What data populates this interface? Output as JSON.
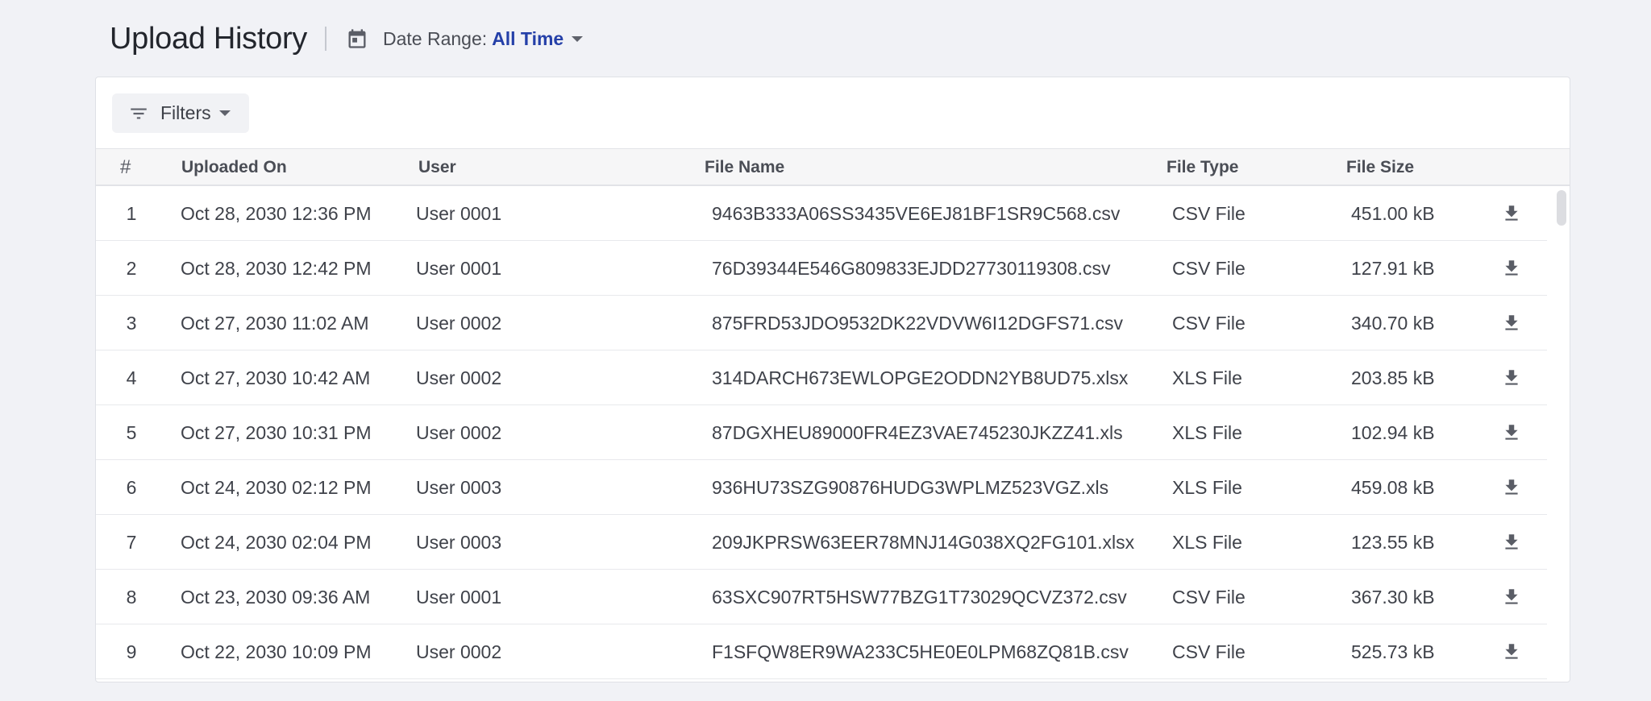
{
  "header": {
    "title": "Upload History",
    "date_range_label": "Date Range:",
    "date_range_value": "All Time"
  },
  "toolbar": {
    "filters_label": "Filters"
  },
  "table": {
    "columns": [
      "#",
      "Uploaded On",
      "User",
      "File Name",
      "File Type",
      "File Size"
    ],
    "rows": [
      {
        "num": "1",
        "uploaded": "Oct 28, 2030 12:36 PM",
        "user": "User 0001",
        "file": "9463B333A06SS3435VE6EJ81BF1SR9C568.csv",
        "type": "CSV File",
        "size": "451.00 kB"
      },
      {
        "num": "2",
        "uploaded": "Oct 28, 2030 12:42 PM",
        "user": "User 0001",
        "file": "76D39344E546G809833EJDD27730119308.csv",
        "type": "CSV File",
        "size": "127.91 kB"
      },
      {
        "num": "3",
        "uploaded": "Oct 27, 2030 11:02 AM",
        "user": "User 0002",
        "file": "875FRD53JDO9532DK22VDVW6I12DGFS71.csv",
        "type": "CSV File",
        "size": "340.70 kB"
      },
      {
        "num": "4",
        "uploaded": "Oct 27, 2030 10:42 AM",
        "user": "User 0002",
        "file": "314DARCH673EWLOPGE2ODDN2YB8UD75.xlsx",
        "type": "XLS File",
        "size": "203.85 kB"
      },
      {
        "num": "5",
        "uploaded": "Oct 27, 2030 10:31 PM",
        "user": "User 0002",
        "file": "87DGXHEU89000FR4EZ3VAE745230JKZZ41.xls",
        "type": "XLS File",
        "size": "102.94 kB"
      },
      {
        "num": "6",
        "uploaded": "Oct 24, 2030 02:12 PM",
        "user": "User 0003",
        "file": "936HU73SZG90876HUDG3WPLMZ523VGZ.xls",
        "type": "XLS File",
        "size": "459.08 kB"
      },
      {
        "num": "7",
        "uploaded": "Oct 24, 2030 02:04 PM",
        "user": "User 0003",
        "file": "209JKPRSW63EER78MNJ14G038XQ2FG101.xlsx",
        "type": "XLS File",
        "size": "123.55 kB"
      },
      {
        "num": "8",
        "uploaded": "Oct 23, 2030 09:36 AM",
        "user": "User 0001",
        "file": "63SXC907RT5HSW77BZG1T73029QCVZ372.csv",
        "type": "CSV File",
        "size": "367.30 kB"
      },
      {
        "num": "9",
        "uploaded": "Oct 22, 2030 10:09 PM",
        "user": "User 0002",
        "file": "F1SFQW8ER9WA233C5HE0E0LPM68ZQ81B.csv",
        "type": "CSV File",
        "size": "525.73 kB"
      }
    ]
  },
  "icons": {
    "calendar": "calendar-icon",
    "filter": "filter-icon",
    "download": "download-icon"
  },
  "colors": {
    "accent": "#2540a8",
    "background": "#f1f2f6"
  }
}
